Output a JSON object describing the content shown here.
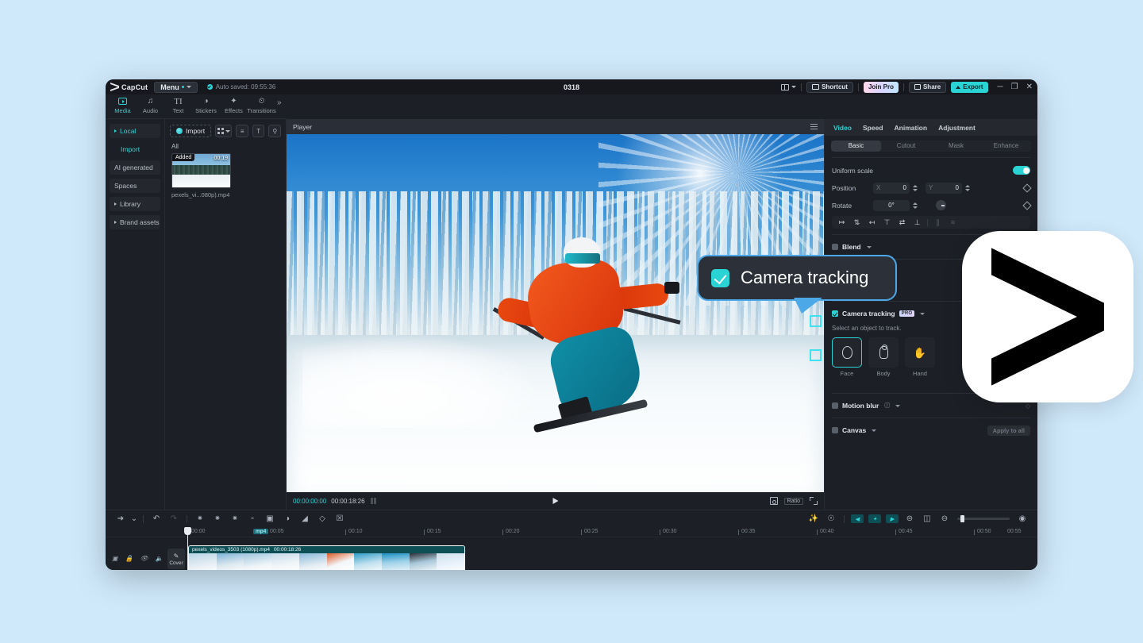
{
  "app": {
    "brand": "CapCut",
    "menu_label": "Menu",
    "autosave": "Auto saved: 09:55:36",
    "project_title": "0318"
  },
  "titlebar": {
    "shortcut_label": "Shortcut",
    "join_pro_label": "Join Pro",
    "share_label": "Share",
    "export_label": "Export",
    "minimize": "─",
    "maximize": "❐",
    "close": "✕"
  },
  "tool_tabs": [
    {
      "label": "Media",
      "icon": "media-icon",
      "active": true
    },
    {
      "label": "Audio",
      "icon": "audio-icon",
      "active": false
    },
    {
      "label": "Text",
      "icon": "text-icon",
      "active": false
    },
    {
      "label": "Stickers",
      "icon": "stickers-icon",
      "active": false
    },
    {
      "label": "Effects",
      "icon": "effects-icon",
      "active": false
    },
    {
      "label": "Transitions",
      "icon": "transitions-icon",
      "active": false
    }
  ],
  "tool_tabs_more": "»",
  "sidebar": {
    "items": [
      {
        "label": "Local",
        "expandable": true,
        "active": true
      },
      {
        "label": "Import",
        "sub": true,
        "active": true
      },
      {
        "label": "AI generated",
        "expandable": false
      },
      {
        "label": "Spaces",
        "expandable": false
      },
      {
        "label": "Library",
        "expandable": true
      },
      {
        "label": "Brand assets",
        "expandable": true
      }
    ]
  },
  "media": {
    "import_label": "Import",
    "filter_label": "All",
    "view_icon": "grid-view-icon",
    "sort_icon": "sort-icon",
    "type_icon": "text-filter-icon",
    "search_icon": "search-icon",
    "asset": {
      "badge": "Added",
      "duration": "00:19",
      "name": "pexels_vi...080p).mp4"
    }
  },
  "player": {
    "title": "Player",
    "menu_icon": "hamburger-icon",
    "current_time": "00:00:00:00",
    "total_time": "00:00:18:26",
    "play_icon": "play-icon",
    "ratio_label": "Ratio",
    "crop_icon": "crop-icon",
    "fullscreen_icon": "fullscreen-icon"
  },
  "callout": {
    "text": "Camera tracking",
    "checkbox_checked": true
  },
  "inspector": {
    "tabs": [
      {
        "label": "Video",
        "active": true
      },
      {
        "label": "Speed",
        "active": false
      },
      {
        "label": "Animation",
        "active": false
      },
      {
        "label": "Adjustment",
        "active": false
      }
    ],
    "subtabs": [
      {
        "label": "Basic",
        "active": true
      },
      {
        "label": "Cutout",
        "active": false
      },
      {
        "label": "Mask",
        "active": false
      },
      {
        "label": "Enhance",
        "active": false
      }
    ],
    "uniform_scale": {
      "label": "Uniform scale",
      "enabled": true
    },
    "position": {
      "label": "Position",
      "x_axis": "X",
      "x_value": "0",
      "y_axis": "Y",
      "y_value": "0"
    },
    "rotate": {
      "label": "Rotate",
      "value": "0°"
    },
    "align_icons": [
      "align-left-icon",
      "align-center-horizontal-icon",
      "align-right-icon",
      "align-top-icon",
      "align-center-vertical-icon",
      "align-bottom-icon",
      "distribute-horizontal-icon",
      "distribute-vertical-icon"
    ],
    "blend": {
      "label": "Blend",
      "checked": false
    },
    "camera_tracking": {
      "label": "Camera tracking",
      "badge": "PRO",
      "checked": true,
      "hint": "Select an object to track.",
      "objects": [
        {
          "label": "Face",
          "icon": "face-icon",
          "selected": true
        },
        {
          "label": "Body",
          "icon": "body-icon",
          "selected": false
        },
        {
          "label": "Hand",
          "icon": "hand-icon",
          "selected": false
        }
      ]
    },
    "motion_blur": {
      "label": "Motion blur",
      "checked": false
    },
    "canvas": {
      "label": "Canvas",
      "checked": false,
      "apply_all": "Apply to all"
    }
  },
  "timeline": {
    "tools": [
      {
        "name": "select-tool-icon"
      },
      {
        "name": "tool-dropdown-caret-icon"
      },
      {
        "name": "undo-icon"
      },
      {
        "name": "redo-icon"
      },
      {
        "name": "split-icon"
      },
      {
        "name": "trim-left-icon"
      },
      {
        "name": "trim-right-icon"
      },
      {
        "name": "delete-icon"
      },
      {
        "name": "freeze-icon"
      },
      {
        "name": "speed-icon"
      },
      {
        "name": "mirror-icon"
      },
      {
        "name": "rotate-icon"
      },
      {
        "name": "crop-icon"
      }
    ],
    "right_tools": [
      {
        "name": "auto-captions-icon"
      },
      {
        "name": "record-voiceover-icon"
      },
      {
        "name": "keyframe-prev-icon"
      },
      {
        "name": "keyframe-add-icon"
      },
      {
        "name": "keyframe-next-icon"
      },
      {
        "name": "link-icon"
      },
      {
        "name": "preview-icon"
      },
      {
        "name": "zoom-out-icon"
      },
      {
        "name": "zoom-fit-icon"
      }
    ],
    "ruler_labels": [
      "00:00",
      "00:05",
      "00:10",
      "00:15",
      "00:20",
      "00:25",
      "00:30",
      "00:35",
      "00:40",
      "00:45",
      "00:50",
      "00:55"
    ],
    "mp4_tag": "mp4",
    "track_controls": [
      "lock-frame-icon",
      "lock-icon",
      "hide-icon",
      "mute-icon"
    ],
    "cover_label": "Cover",
    "clip": {
      "name": "pexels_videos_3503 (1080p).mp4",
      "duration": "00:00:18:26"
    }
  },
  "colors": {
    "accent": "#2ad4d4",
    "callout_border": "#4da8e8",
    "window_bg": "#1c1f25",
    "page_bg": "#cfe9fb"
  }
}
